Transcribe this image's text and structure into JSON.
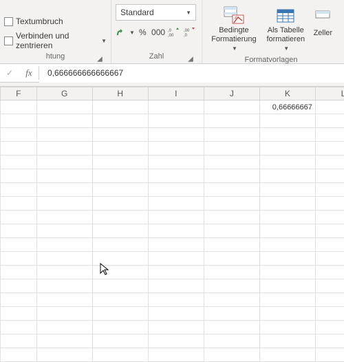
{
  "ribbon": {
    "alignment": {
      "wrap_text": "Textumbruch",
      "merge_center": "Verbinden und zentrieren",
      "label": "htung"
    },
    "number": {
      "format_combo": "Standard",
      "label": "Zahl"
    },
    "styles": {
      "conditional": "Bedingte",
      "conditional2": "Formatierung",
      "table": "Als Tabelle",
      "table2": "formatieren",
      "cell": "Zeller",
      "label": "Formatvorlagen"
    }
  },
  "formula_bar": {
    "fx": "fx",
    "value": "0,666666666666667"
  },
  "grid": {
    "columns": [
      "F",
      "G",
      "H",
      "I",
      "J",
      "K",
      "L"
    ],
    "k1": "0,66666667"
  },
  "icons": {
    "check": "✓",
    "caret": "▾",
    "caretsm": "▼",
    "launcher": "◢"
  }
}
